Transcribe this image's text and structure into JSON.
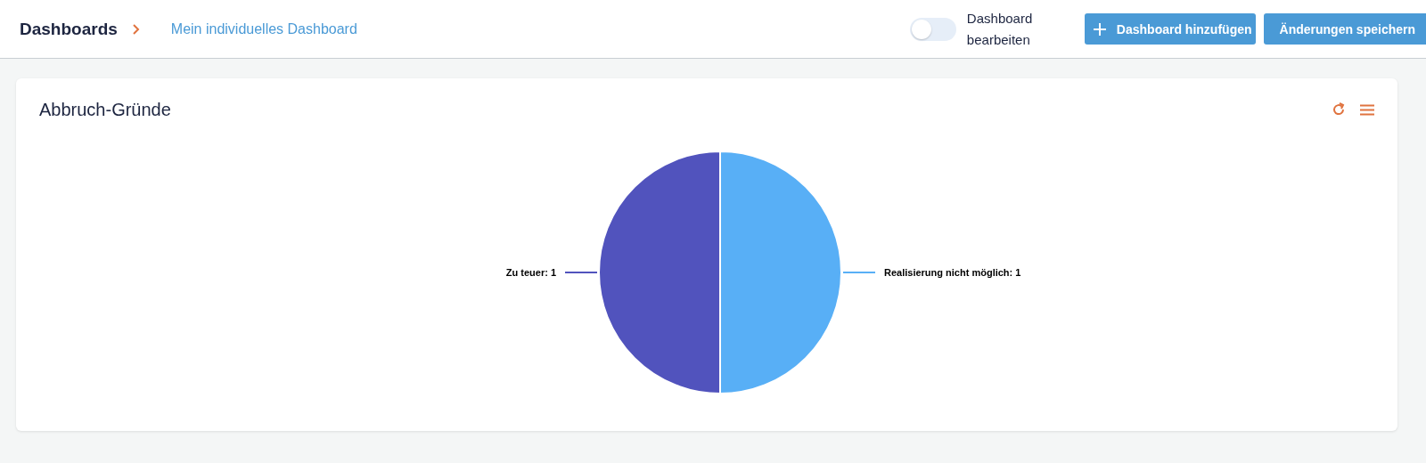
{
  "breadcrumb": {
    "root": "Dashboards",
    "current": "Mein individuelles Dashboard"
  },
  "edit_toggle": {
    "label": "Dashboard bearbeiten",
    "on": false
  },
  "buttons": [
    {
      "kind": "add",
      "label": "Dashboard hinzufügen"
    },
    {
      "kind": "plain",
      "label": "Änderungen speichern"
    }
  ],
  "widget": {
    "title": "Abbruch-Gründe",
    "chart_data": {
      "type": "pie",
      "categories": [
        "Realisierung nicht möglich: 1",
        "Zu teuer: 1"
      ],
      "values": [
        1,
        1
      ],
      "colors": [
        "#58aff6",
        "#5153bd"
      ]
    }
  }
}
